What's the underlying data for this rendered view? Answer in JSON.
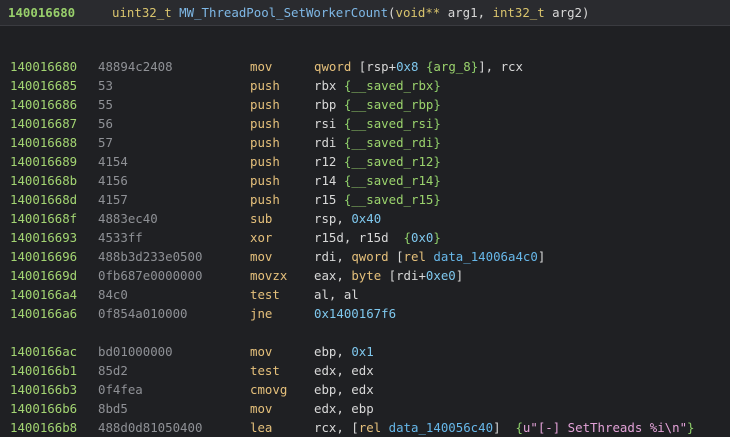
{
  "header": {
    "address": "140016680",
    "signature": [
      {
        "t": "uint32_t",
        "c": "type"
      },
      {
        "t": " ",
        "c": "text"
      },
      {
        "t": "MW_ThreadPool_SetWorkerCount",
        "c": "func"
      },
      {
        "t": "(",
        "c": "punct"
      },
      {
        "t": "void**",
        "c": "type"
      },
      {
        "t": " arg1, ",
        "c": "text"
      },
      {
        "t": "int32_t",
        "c": "type"
      },
      {
        "t": " arg2)",
        "c": "text"
      }
    ]
  },
  "rows": [
    {
      "blank": true
    },
    {
      "addr": "140016680",
      "bytes": "48894c2408",
      "mnem": "mov",
      "ops": [
        {
          "t": "qword",
          "c": "kw"
        },
        {
          "t": " [rsp+",
          "c": "text"
        },
        {
          "t": "0x8",
          "c": "num"
        },
        {
          "t": " ",
          "c": "text"
        },
        {
          "t": "{",
          "c": "brace"
        },
        {
          "t": "arg_8",
          "c": "var"
        },
        {
          "t": "}",
          "c": "brace"
        },
        {
          "t": "], rcx",
          "c": "text"
        }
      ]
    },
    {
      "addr": "140016685",
      "bytes": "53",
      "mnem": "push",
      "ops": [
        {
          "t": "rbx ",
          "c": "reg"
        },
        {
          "t": "{",
          "c": "brace"
        },
        {
          "t": "__saved_rbx",
          "c": "var"
        },
        {
          "t": "}",
          "c": "brace"
        }
      ]
    },
    {
      "addr": "140016686",
      "bytes": "55",
      "mnem": "push",
      "ops": [
        {
          "t": "rbp ",
          "c": "reg"
        },
        {
          "t": "{",
          "c": "brace"
        },
        {
          "t": "__saved_rbp",
          "c": "var"
        },
        {
          "t": "}",
          "c": "brace"
        }
      ]
    },
    {
      "addr": "140016687",
      "bytes": "56",
      "mnem": "push",
      "ops": [
        {
          "t": "rsi ",
          "c": "reg"
        },
        {
          "t": "{",
          "c": "brace"
        },
        {
          "t": "__saved_rsi",
          "c": "var"
        },
        {
          "t": "}",
          "c": "brace"
        }
      ]
    },
    {
      "addr": "140016688",
      "bytes": "57",
      "mnem": "push",
      "ops": [
        {
          "t": "rdi ",
          "c": "reg"
        },
        {
          "t": "{",
          "c": "brace"
        },
        {
          "t": "__saved_rdi",
          "c": "var"
        },
        {
          "t": "}",
          "c": "brace"
        }
      ]
    },
    {
      "addr": "140016689",
      "bytes": "4154",
      "mnem": "push",
      "ops": [
        {
          "t": "r12 ",
          "c": "reg"
        },
        {
          "t": "{",
          "c": "brace"
        },
        {
          "t": "__saved_r12",
          "c": "var"
        },
        {
          "t": "}",
          "c": "brace"
        }
      ]
    },
    {
      "addr": "14001668b",
      "bytes": "4156",
      "mnem": "push",
      "ops": [
        {
          "t": "r14 ",
          "c": "reg"
        },
        {
          "t": "{",
          "c": "brace"
        },
        {
          "t": "__saved_r14",
          "c": "var"
        },
        {
          "t": "}",
          "c": "brace"
        }
      ]
    },
    {
      "addr": "14001668d",
      "bytes": "4157",
      "mnem": "push",
      "ops": [
        {
          "t": "r15 ",
          "c": "reg"
        },
        {
          "t": "{",
          "c": "brace"
        },
        {
          "t": "__saved_r15",
          "c": "var"
        },
        {
          "t": "}",
          "c": "brace"
        }
      ]
    },
    {
      "addr": "14001668f",
      "bytes": "4883ec40",
      "mnem": "sub",
      "ops": [
        {
          "t": "rsp, ",
          "c": "reg"
        },
        {
          "t": "0x40",
          "c": "num"
        }
      ]
    },
    {
      "addr": "140016693",
      "bytes": "4533ff",
      "mnem": "xor",
      "ops": [
        {
          "t": "r15d, r15d  ",
          "c": "reg"
        },
        {
          "t": "{",
          "c": "brace"
        },
        {
          "t": "0x0",
          "c": "num"
        },
        {
          "t": "}",
          "c": "brace"
        }
      ]
    },
    {
      "addr": "140016696",
      "bytes": "488b3d233e0500",
      "mnem": "mov",
      "ops": [
        {
          "t": "rdi, ",
          "c": "reg"
        },
        {
          "t": "qword",
          "c": "kw"
        },
        {
          "t": " [",
          "c": "text"
        },
        {
          "t": "rel",
          "c": "kw"
        },
        {
          "t": " ",
          "c": "text"
        },
        {
          "t": "data_14006a4c0",
          "c": "sym"
        },
        {
          "t": "]",
          "c": "text"
        }
      ]
    },
    {
      "addr": "14001669d",
      "bytes": "0fb687e0000000",
      "mnem": "movzx",
      "ops": [
        {
          "t": "eax, ",
          "c": "reg"
        },
        {
          "t": "byte",
          "c": "kw"
        },
        {
          "t": " [rdi+",
          "c": "text"
        },
        {
          "t": "0xe0",
          "c": "num"
        },
        {
          "t": "]",
          "c": "text"
        }
      ]
    },
    {
      "addr": "1400166a4",
      "bytes": "84c0",
      "mnem": "test",
      "ops": [
        {
          "t": "al, al",
          "c": "reg"
        }
      ]
    },
    {
      "addr": "1400166a6",
      "bytes": "0f854a010000",
      "mnem": "jne",
      "ops": [
        {
          "t": "0x1400167f6",
          "c": "num"
        }
      ]
    },
    {
      "blank": true
    },
    {
      "addr": "1400166ac",
      "bytes": "bd01000000",
      "mnem": "mov",
      "ops": [
        {
          "t": "ebp, ",
          "c": "reg"
        },
        {
          "t": "0x1",
          "c": "num"
        }
      ]
    },
    {
      "addr": "1400166b1",
      "bytes": "85d2",
      "mnem": "test",
      "ops": [
        {
          "t": "edx, edx",
          "c": "reg"
        }
      ]
    },
    {
      "addr": "1400166b3",
      "bytes": "0f4fea",
      "mnem": "cmovg",
      "ops": [
        {
          "t": "ebp, edx",
          "c": "reg"
        }
      ]
    },
    {
      "addr": "1400166b6",
      "bytes": "8bd5",
      "mnem": "mov",
      "ops": [
        {
          "t": "edx, ebp",
          "c": "reg"
        }
      ]
    },
    {
      "addr": "1400166b8",
      "bytes": "488d0d81050400",
      "mnem": "lea",
      "ops": [
        {
          "t": "rcx, [",
          "c": "reg"
        },
        {
          "t": "rel",
          "c": "kw"
        },
        {
          "t": " ",
          "c": "text"
        },
        {
          "t": "data_140056c40",
          "c": "sym"
        },
        {
          "t": "]  ",
          "c": "text"
        },
        {
          "t": "{",
          "c": "brace"
        },
        {
          "t": "u\"[-] SetThreads %i\\n\"",
          "c": "str"
        },
        {
          "t": "}",
          "c": "brace"
        }
      ]
    }
  ],
  "colors": {
    "background": "#1f2023",
    "header_background": "#2a2b2f",
    "address": "#a3d572",
    "mnemonic": "#e5c07b",
    "number": "#7fc8ee",
    "variable": "#9bd36d",
    "string": "#e3a2d8"
  }
}
